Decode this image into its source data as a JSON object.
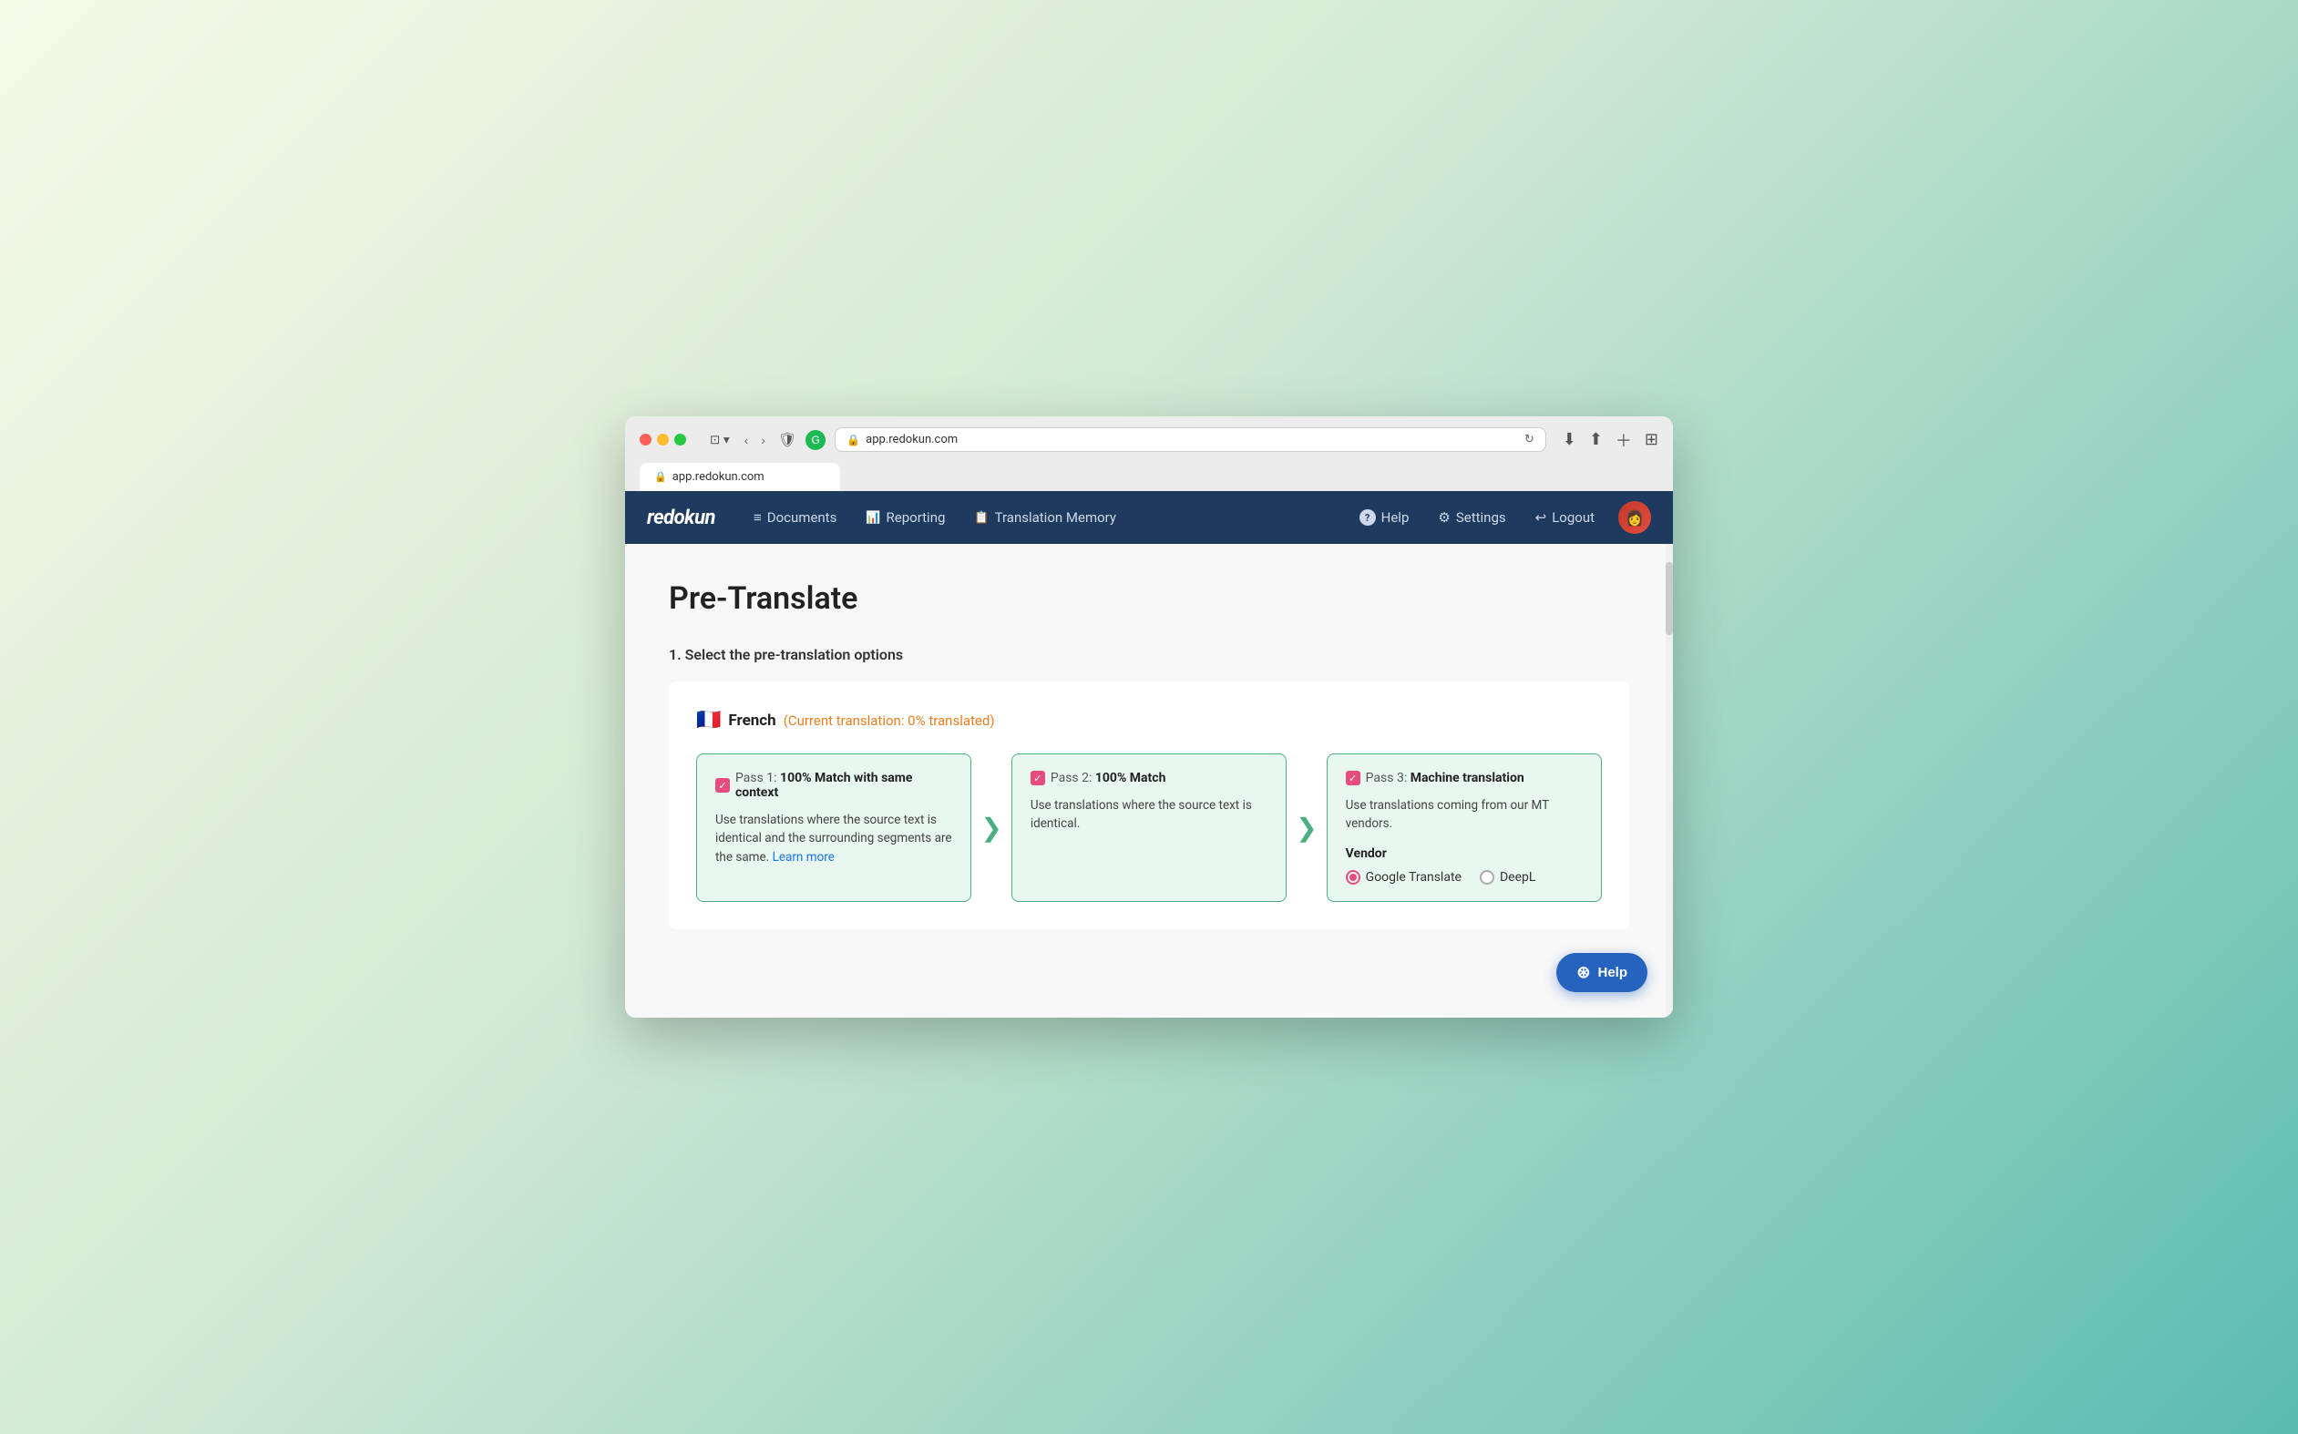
{
  "browser": {
    "url": "app.redokun.com",
    "tab_title": "app.redokun.com"
  },
  "nav": {
    "logo": "redokun",
    "links": [
      {
        "id": "documents",
        "label": "Documents",
        "icon": "≡"
      },
      {
        "id": "reporting",
        "label": "Reporting",
        "icon": "📊"
      },
      {
        "id": "translation-memory",
        "label": "Translation Memory",
        "icon": "📋"
      }
    ],
    "right_links": [
      {
        "id": "help",
        "label": "Help",
        "icon": "?"
      },
      {
        "id": "settings",
        "label": "Settings",
        "icon": "⚙"
      },
      {
        "id": "logout",
        "label": "Logout",
        "icon": "→"
      }
    ]
  },
  "page": {
    "title": "Pre-Translate",
    "section_header": "1. Select the pre-translation options",
    "language": {
      "flag": "🇫🇷",
      "name": "French",
      "status": "(Current translation: 0% translated)"
    },
    "passes": [
      {
        "id": "pass1",
        "checked": true,
        "label_prefix": "Pass 1:",
        "label_bold": "100% Match with same context",
        "description": "Use translations where the source text is identical and the surrounding segments are the same.",
        "learn_more_label": "Learn more",
        "learn_more_url": "#"
      },
      {
        "id": "pass2",
        "checked": true,
        "label_prefix": "Pass 2:",
        "label_bold": "100% Match",
        "description": "Use translations where the source text is identical."
      },
      {
        "id": "pass3",
        "checked": true,
        "label_prefix": "Pass 3:",
        "label_bold": "Machine translation",
        "description": "Use translations coming from our MT vendors.",
        "vendor_label": "Vendor",
        "vendors": [
          {
            "id": "google",
            "label": "Google Translate",
            "selected": true
          },
          {
            "id": "deepl",
            "label": "DeepL",
            "selected": false
          }
        ]
      }
    ],
    "help_button_label": "Help"
  }
}
